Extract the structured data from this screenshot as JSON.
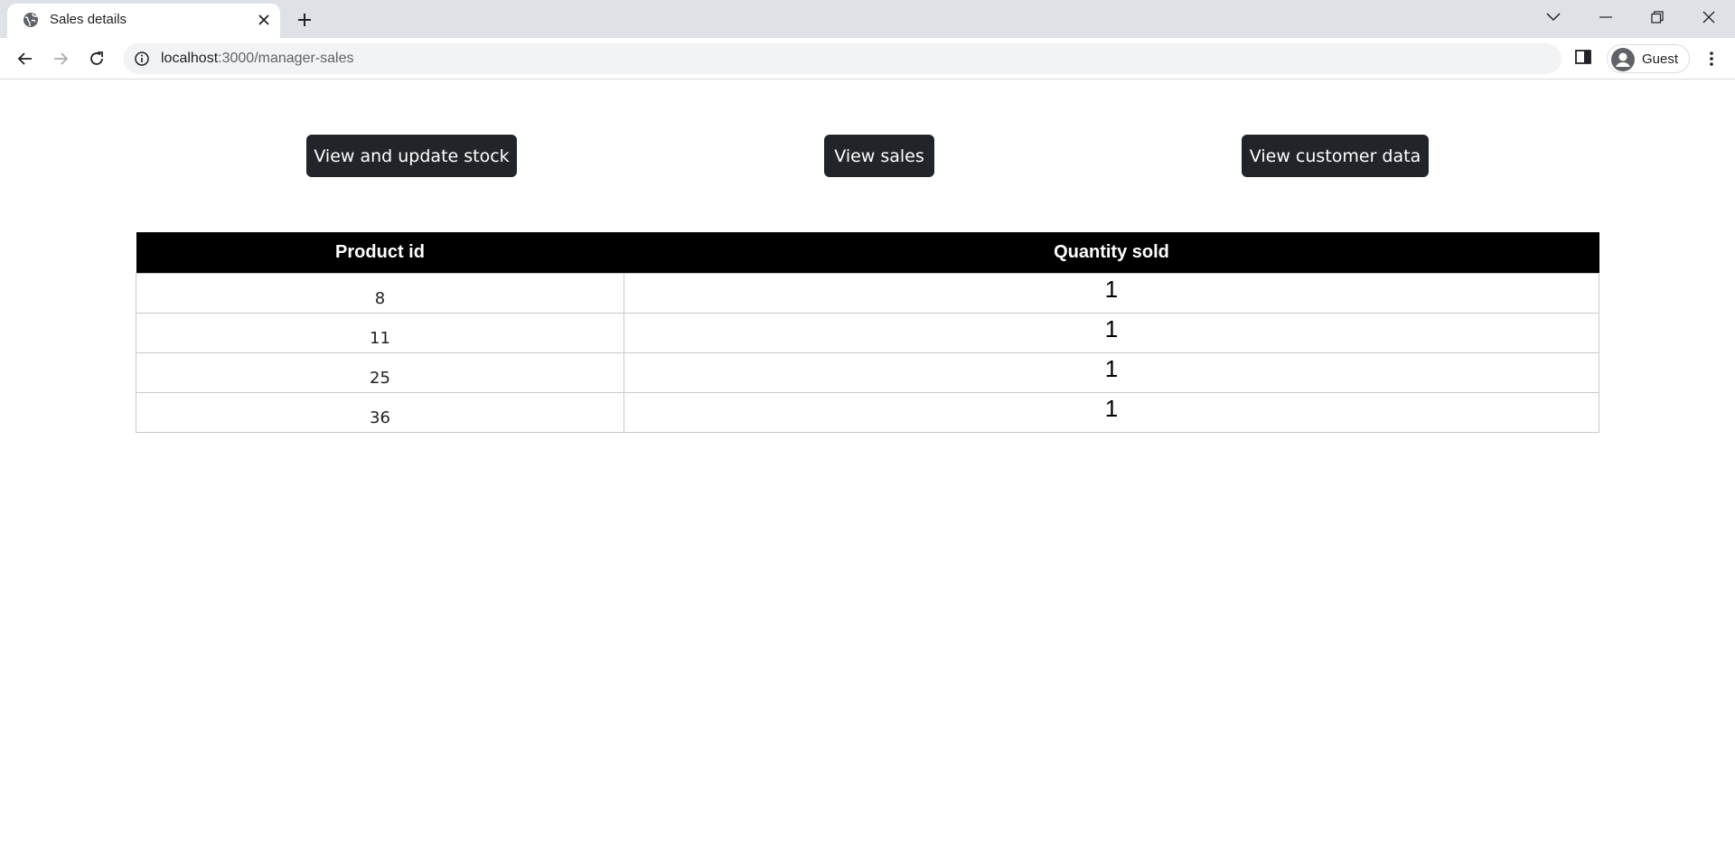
{
  "browser": {
    "tab": {
      "title": "Sales details",
      "favicon": "globe-icon"
    },
    "new_tab_icon": "plus-icon",
    "window_controls": [
      "chevron-down-icon",
      "minimize-icon",
      "restore-icon",
      "close-icon"
    ],
    "address": {
      "host": "localhost",
      "path": ":3000/manager-sales"
    },
    "profile": {
      "label": "Guest",
      "icon": "avatar-icon"
    }
  },
  "page": {
    "buttons": {
      "stock": "View and update stock",
      "sales": "View sales",
      "customer": "View customer data"
    },
    "table": {
      "headers": {
        "product_id": "Product id",
        "quantity": "Quantity sold"
      },
      "rows": [
        {
          "product_id": "8",
          "quantity": "1"
        },
        {
          "product_id": "11",
          "quantity": "1"
        },
        {
          "product_id": "25",
          "quantity": "1"
        },
        {
          "product_id": "36",
          "quantity": "1"
        }
      ]
    }
  },
  "colors": {
    "button_bg": "#212529",
    "table_header_bg": "#000000",
    "tabstrip_bg": "#dee1e6"
  }
}
